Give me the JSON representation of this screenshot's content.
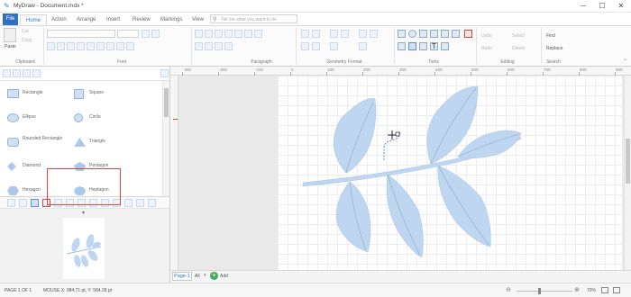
{
  "window": {
    "title": "MyDraw - Document.mdx *",
    "minimize_glyph": "─",
    "maximize_glyph": "☐",
    "close_glyph": "✕"
  },
  "ribbon_tabs": [
    "File",
    "Home",
    "Action",
    "Arrange",
    "Insert",
    "Review",
    "Markings",
    "View"
  ],
  "active_tab": "Home",
  "tell_me": {
    "placeholder": "Tell me what you want to do"
  },
  "ribbon": {
    "clipboard": {
      "paste": "Paste",
      "cut": "Cut",
      "copy": "Copy",
      "label": "Clipboard"
    },
    "font": {
      "label": "Font"
    },
    "paragraph": {
      "label": "Paragraph"
    },
    "geometry_format": {
      "label": "Geometry Format"
    },
    "tools": {
      "label": "Tools"
    },
    "editing": {
      "undo": "Undo",
      "redo": "Redo",
      "select": "Select",
      "delete": "Delete",
      "label": "Editing"
    },
    "search": {
      "find": "Find",
      "replace": "Replace",
      "label": "Search"
    }
  },
  "shapes": [
    {
      "label": "Rectangle",
      "shape": "rect"
    },
    {
      "label": "Square",
      "shape": "square"
    },
    {
      "label": "Ellipse",
      "shape": "ellipse"
    },
    {
      "label": "Circle",
      "shape": "circle"
    },
    {
      "label": "Rounded Rectangle",
      "shape": "rounded"
    },
    {
      "label": "Triangle",
      "shape": "triangle"
    },
    {
      "label": "Diamond",
      "shape": "diamond"
    },
    {
      "label": "Pentagon",
      "shape": "pentagon"
    },
    {
      "label": "Hexagon",
      "shape": "hexagon"
    },
    {
      "label": "Heptagon",
      "shape": "heptagon"
    }
  ],
  "ruler_top": [
    "-300",
    "-200",
    "-100",
    "0",
    "100",
    "200",
    "300",
    "400",
    "500",
    "600",
    "700",
    "800",
    "900"
  ],
  "page_tabs": {
    "page": "Page-1",
    "all": "All",
    "add": "Add"
  },
  "status": {
    "page": "PAGE 1 OF 1",
    "mouse": "MOUSE X: 984.71 pt, Y: 584.28 pt",
    "zoom": "70%"
  },
  "colors": {
    "accent": "#2f6fc4",
    "leaf_fill": "#bfd6f1",
    "leaf_vein": "#8ea9c8",
    "selection_red": "#e0453a"
  }
}
